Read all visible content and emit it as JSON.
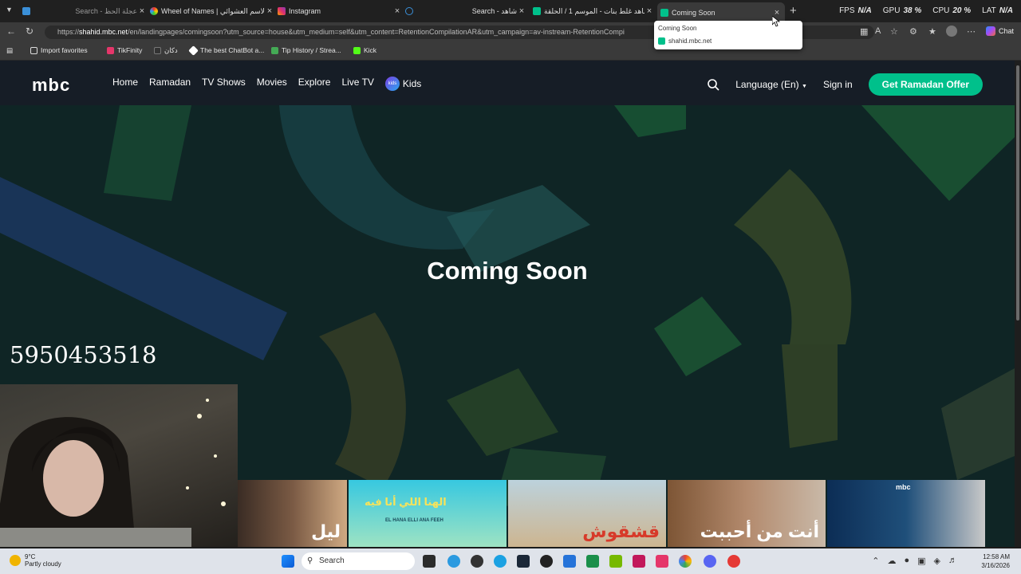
{
  "browser": {
    "tabs": [
      {
        "title": "Search - عجلة الحظ",
        "active": false,
        "icon": "search-icon"
      },
      {
        "title": "Wheel of Names | الاسم العشوائي",
        "active": false,
        "icon": "wheel-icon"
      },
      {
        "title": "Instagram",
        "active": false,
        "icon": "instagram-icon"
      },
      {
        "title": "Search - شاهد",
        "active": false,
        "icon": "search-icon"
      },
      {
        "title": "شاهد غلط بنات - الموسم 1 / الحلقة",
        "active": false,
        "icon": "shahid-icon"
      },
      {
        "title": "Coming Soon",
        "active": true,
        "icon": "shahid-icon"
      }
    ],
    "new_tab": "+",
    "close": "×",
    "hud": {
      "fps_label": "FPS",
      "fps": "N/A",
      "gpu_label": "GPU",
      "gpu": "38 %",
      "cpu_label": "CPU",
      "cpu": "20 %",
      "lat_label": "LAT",
      "lat": "N/A"
    },
    "url_prefix": "https://",
    "url_host": "shahid.mbc.net",
    "url_path": "/en/landingpages/comingsoon?utm_source=house&utm_medium=self&utm_content=RetentionCompilationAR&utm_campaign=av-instream-RetentionCompi",
    "chat": "Chat",
    "bookmarks": [
      "Import favorites",
      "TikFinity",
      "دكان",
      "The best ChatBot a...",
      "Tip History / Strea...",
      "Kick"
    ],
    "tooltip": {
      "title": "Coming Soon",
      "domain": "shahid.mbc.net"
    }
  },
  "site": {
    "logo": "mbc",
    "nav": [
      "Home",
      "Ramadan",
      "TV Shows",
      "Movies",
      "Explore",
      "Live TV",
      "Kids"
    ],
    "kids_badge": "kids",
    "language": "Language (En)",
    "signin": "Sign in",
    "cta": "Get Ramadan Offer",
    "heading": "Coming Soon",
    "overlay_code": "5950453518",
    "posters": [
      "ليل",
      "الهنا اللي أنا فيه",
      "قشقوش",
      "أنت من أحببت",
      ""
    ],
    "poster_sub": "EL HANA ELLI ANA FEEH",
    "poster_brand": "mbc",
    "colors": {
      "accent": "#00c08b",
      "header": "#161d26",
      "hero": "#0f2525"
    }
  },
  "taskbar": {
    "temp": "9°C",
    "weather": "Partly cloudy",
    "search": "Search",
    "time": "12:58 AM",
    "date": "3/16/2026"
  }
}
